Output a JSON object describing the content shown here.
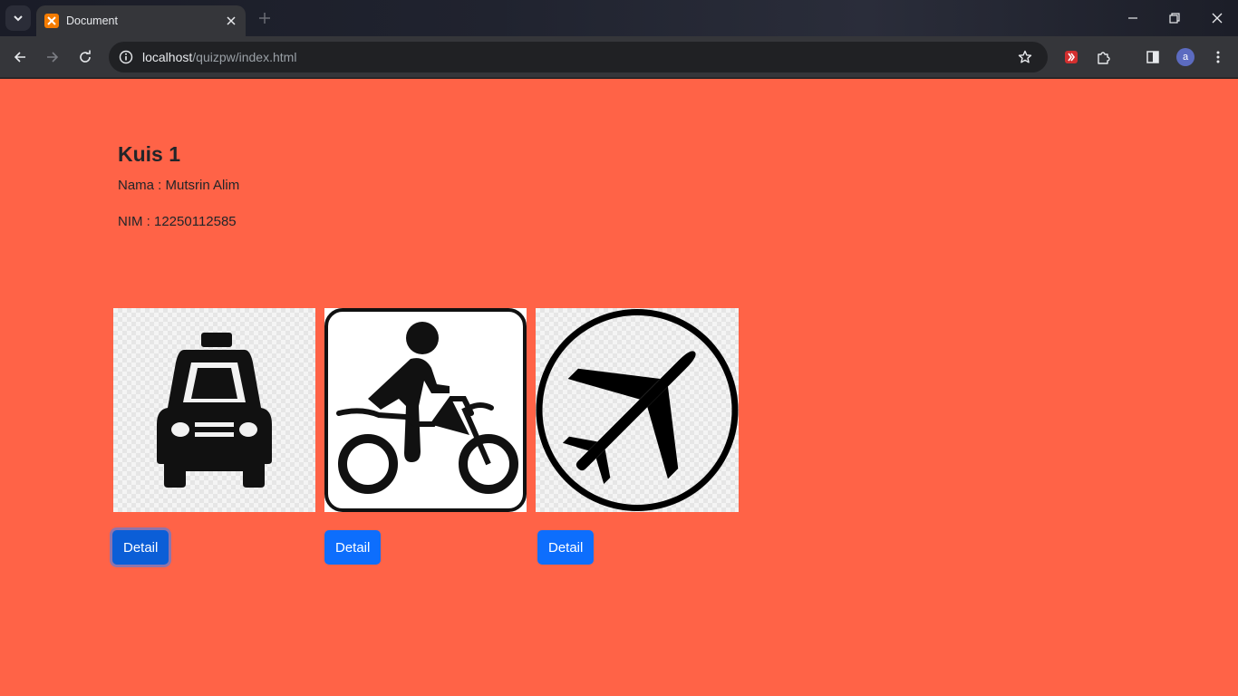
{
  "browser": {
    "tab_title": "Document",
    "url_host": "localhost",
    "url_path": "/quizpw/index.html",
    "profile_initial": "a"
  },
  "page": {
    "background": "#ff6347",
    "heading": "Kuis 1",
    "name_label": "Nama : Mutsrin Alim",
    "nim_label": "NIM : 12250112585",
    "cards": [
      {
        "icon": "taxi-icon",
        "button_label": "Detail"
      },
      {
        "icon": "motorcycle-icon",
        "button_label": "Detail"
      },
      {
        "icon": "airplane-icon",
        "button_label": "Detail"
      }
    ],
    "button_color": "#0d6efd"
  }
}
